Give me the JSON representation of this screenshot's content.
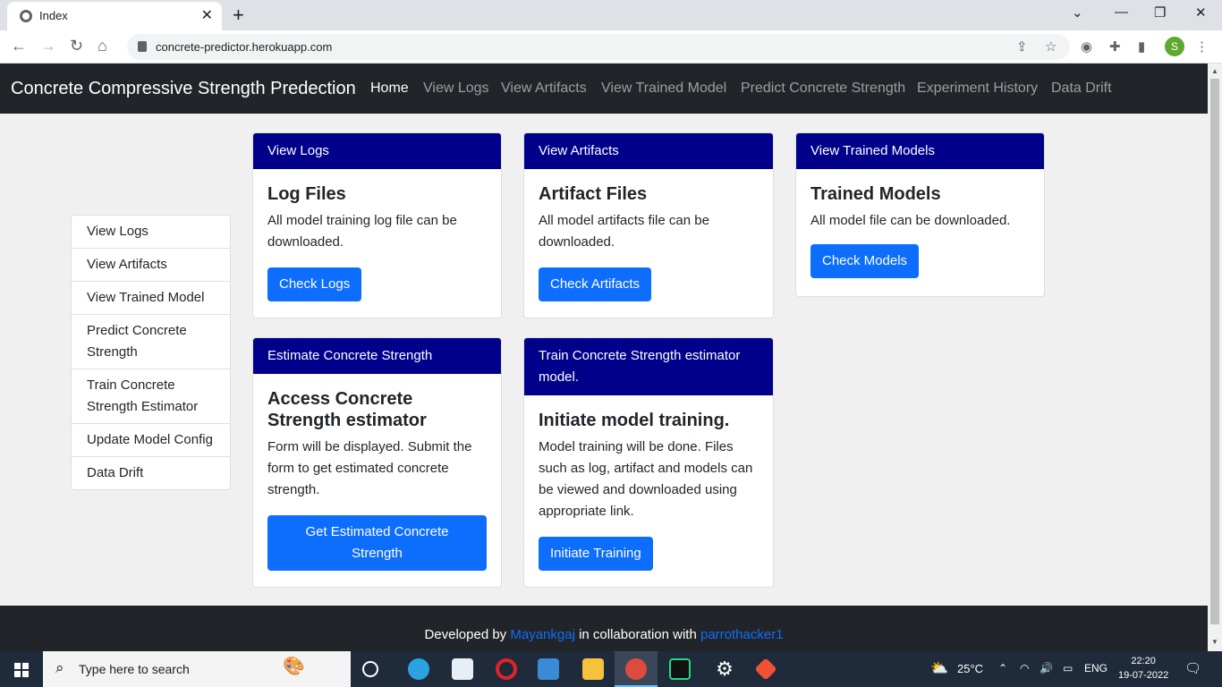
{
  "browser": {
    "tab_title": "Index",
    "url": "concrete-predictor.herokuapp.com",
    "profile_initial": "S"
  },
  "navbar": {
    "brand": "Concrete Compressive Strength Predection",
    "links": [
      "Home",
      "View Logs",
      "View Artifacts",
      "View Trained Model",
      "Predict Concrete Strength",
      "Experiment History",
      "Data Drift"
    ]
  },
  "sidebar": {
    "items": [
      "View Logs",
      "View Artifacts",
      "View Trained Model",
      "Predict Concrete Strength",
      "Train Concrete Strength Estimator",
      "Update Model Config",
      "Data Drift"
    ]
  },
  "cards": [
    {
      "header": "View Logs",
      "title": "Log Files",
      "text": "All model training log file can be downloaded.",
      "button": "Check Logs"
    },
    {
      "header": "View Artifacts",
      "title": "Artifact Files",
      "text": "All model artifacts file can be downloaded.",
      "button": "Check Artifacts"
    },
    {
      "header": "View Trained Models",
      "title": "Trained Models",
      "text": "All model file can be downloaded.",
      "button": "Check Models"
    },
    {
      "header": "Estimate Concrete Strength",
      "title": "Access Concrete Strength estimator",
      "text": "Form will be displayed. Submit the form to get estimated concrete strength.",
      "button": "Get Estimated Concrete Strength"
    },
    {
      "header": "Train Concrete Strength estimator model.",
      "title": "Initiate model training.",
      "text": "Model training will be done. Files such as log, artifact and models can be viewed and downloaded using appropriate link.",
      "button": "Initiate Training"
    }
  ],
  "footer": {
    "prefix": "Developed by ",
    "author1": "Mayankgaj",
    "middle": " in collaboration with ",
    "author2": "parrothacker1"
  },
  "taskbar": {
    "search_placeholder": "Type here to search",
    "temperature": "25°C",
    "language": "ENG",
    "time": "22:20",
    "date": "19-07-2022"
  },
  "colors": {
    "navbar_bg": "#212529",
    "card_header_bg": "#00008b",
    "button_bg": "#0d6efd",
    "link_color": "#0d6efd"
  }
}
